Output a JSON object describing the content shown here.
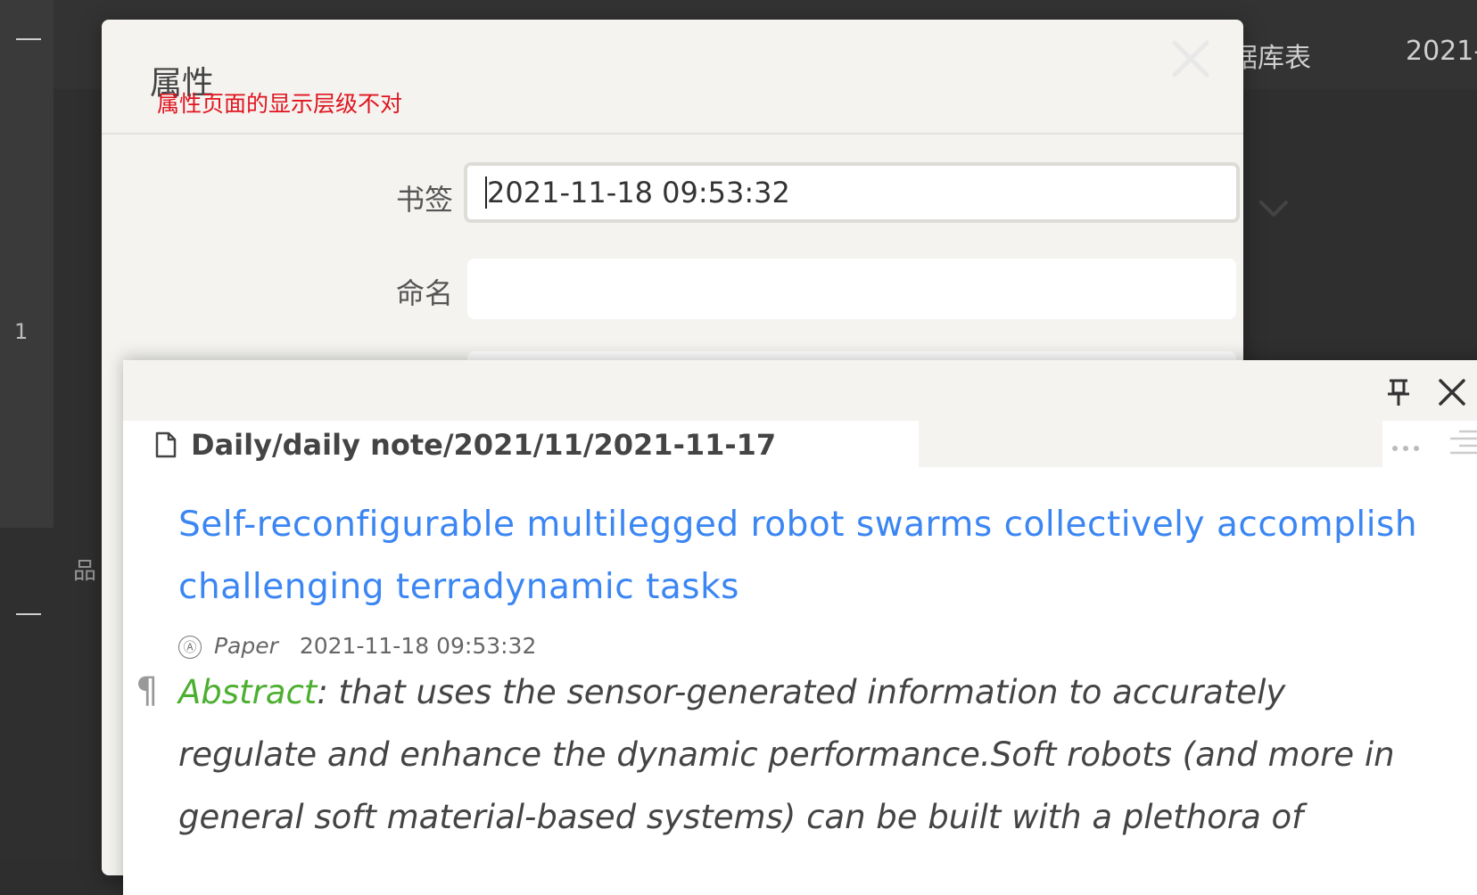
{
  "background": {
    "line_number": "1",
    "tab_fragment": "据库表",
    "date_fragment": "2021-",
    "sidebar_fragment": "品"
  },
  "properties_dialog": {
    "title": "属性",
    "annotation": "属性页面的显示层级不对",
    "close_icon": "close-icon",
    "fields": {
      "bookmark_label": "书签",
      "bookmark_value": "2021-11-18 09:53:32",
      "name_label": "命名",
      "name_value": ""
    },
    "dropdown_icon": "chevron-down-icon"
  },
  "preview_popup": {
    "pin_icon": "pin-icon",
    "close_icon": "close-icon",
    "breadcrumb": "Daily/daily note/2021/11/2021-11-17",
    "more_icon": "more-icon",
    "outline_icon": "outline-icon",
    "doc_title": "Self-reconfigurable multilegged robot swarms collectively accomplish challenging terradynamic tasks",
    "meta": {
      "author_icon": "Ⓐ",
      "type": "Paper",
      "date": "2021-11-18 09:53:32"
    },
    "pilcrow": "¶",
    "abstract_label": "Abstract",
    "abstract_text": ": that uses the sensor-generated information to accurately regulate and enhance the dynamic performance.Soft robots (and more in general soft material-based systems) can be built with a plethora of"
  },
  "colors": {
    "annotation": "#e0141e",
    "link_title": "#3b86f3",
    "abstract_label": "#4caf30"
  }
}
